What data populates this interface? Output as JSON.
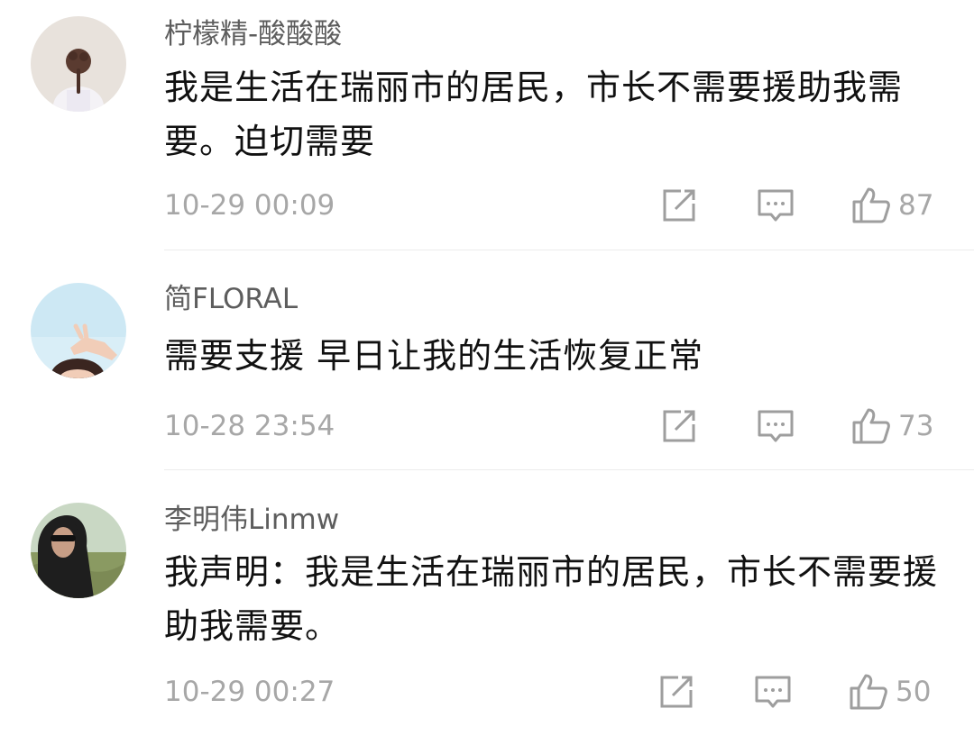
{
  "comments": [
    {
      "username": "柠檬精-酸酸酸",
      "text": "我是生活在瑞丽市的居民，市长不需要援助我需要。迫切需要",
      "time": "10-29 00:09",
      "likes": "87",
      "avatar_icon": "avatar-girl-back-view"
    },
    {
      "username": "简FLORAL",
      "text": "需要支援 早日让我的生活恢复正常",
      "time": "10-28 23:54",
      "likes": "73",
      "avatar_icon": "avatar-girl-hand-sky"
    },
    {
      "username": "李明伟Linmw",
      "text": "我声明：我是生活在瑞丽市的居民，市长不需要援助我需要。",
      "time": "10-29 00:27",
      "likes": "50",
      "avatar_icon": "avatar-man-sunglasses-hood"
    }
  ],
  "icons": {
    "share": "share-icon",
    "reply": "comment-icon",
    "like": "thumbs-up-icon"
  },
  "colors": {
    "username": "#5d5d5d",
    "text": "#111111",
    "meta": "#a7a7a7",
    "icon": "#9e9e9e",
    "divider": "#ececec"
  }
}
